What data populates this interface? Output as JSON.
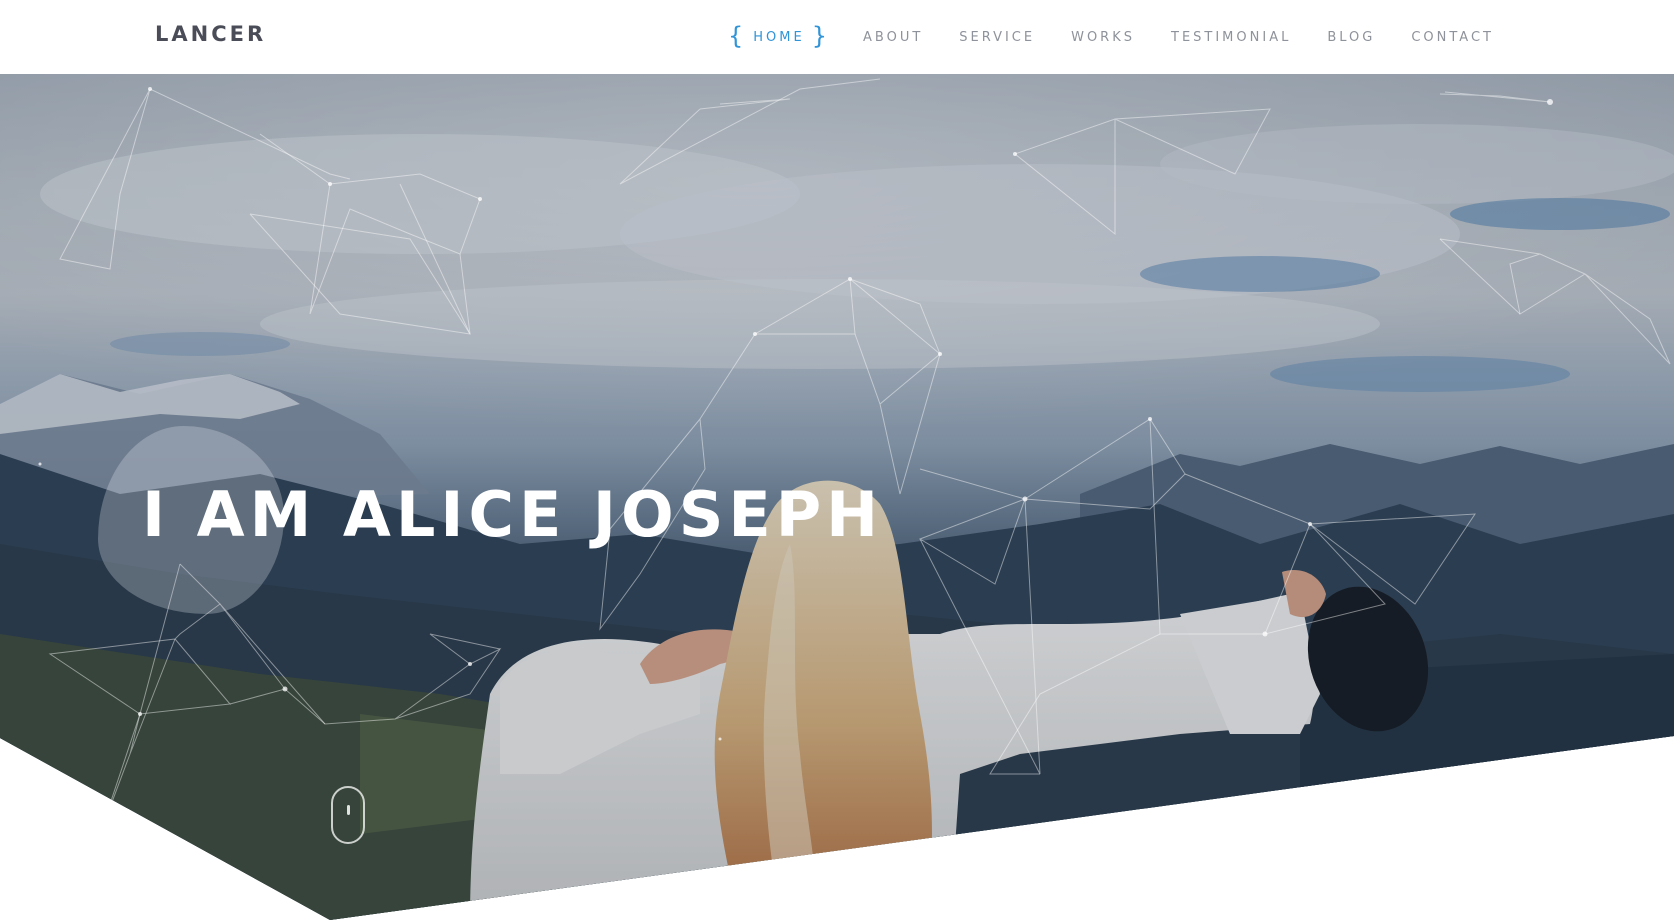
{
  "brand": {
    "name": "LANCER"
  },
  "nav": {
    "brace_left": "{",
    "brace_right": "}",
    "items": [
      {
        "label": "HOME",
        "active": true
      },
      {
        "label": "ABOUT",
        "active": false
      },
      {
        "label": "SERVICE",
        "active": false
      },
      {
        "label": "WORKS",
        "active": false
      },
      {
        "label": "TESTIMONIAL",
        "active": false
      },
      {
        "label": "BLOG",
        "active": false
      },
      {
        "label": "CONTACT",
        "active": false
      }
    ]
  },
  "hero": {
    "title": "I AM ALICE JOSEPH",
    "scroll_icon": "mouse-scroll-icon"
  },
  "colors": {
    "accent": "#2f94d8",
    "brand_text": "#4a4d57",
    "nav_text": "#8e929a",
    "hero_title": "#ffffff"
  }
}
